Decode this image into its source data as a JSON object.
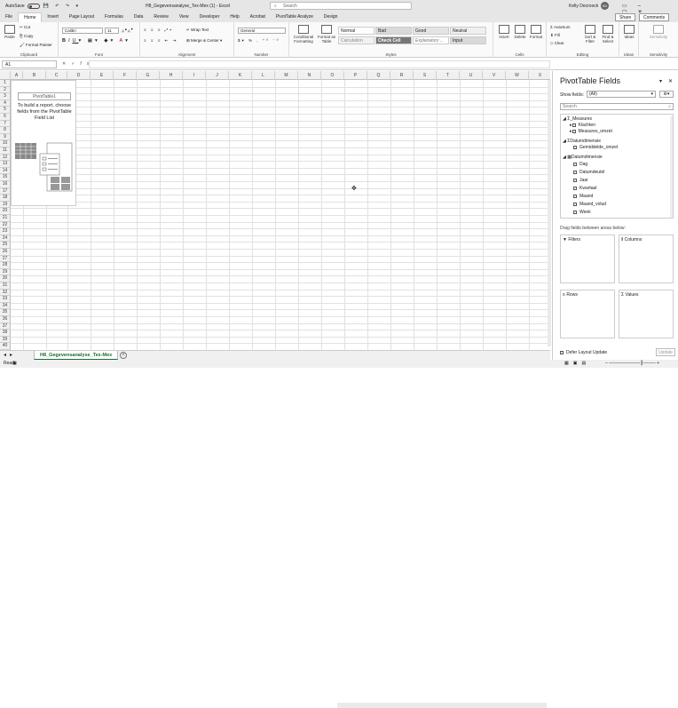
{
  "titlebar": {
    "autosave": "AutoSave",
    "toggle_state": "Off",
    "title": "H8_Gegevensanalyse_Tex-Mex (1) - Excel",
    "search_placeholder": "Search",
    "user": "Kelly Decroock",
    "avatar": "KD"
  },
  "menu": {
    "tabs": [
      "File",
      "Home",
      "Insert",
      "Page Layout",
      "Formulas",
      "Data",
      "Review",
      "View",
      "Developer",
      "Help",
      "Acrobat",
      "PivotTable Analyze",
      "Design"
    ],
    "share": "Share",
    "comments": "Comments"
  },
  "ribbon": {
    "clipboard": {
      "label": "Clipboard",
      "paste": "Paste",
      "cut": "Cut",
      "copy": "Copy",
      "format_painter": "Format Painter"
    },
    "font": {
      "label": "Font",
      "name": "Calibri",
      "size": "11"
    },
    "alignment": {
      "label": "Alignment",
      "wrap": "Wrap Text",
      "merge": "Merge & Center"
    },
    "number": {
      "label": "Number",
      "format": "General"
    },
    "styles": {
      "label": "Styles",
      "conditional": "Conditional Formatting",
      "format_table": "Format as Table",
      "cells": [
        "Normal",
        "Bad",
        "Good",
        "Neutral",
        "Calculation",
        "Check Cell",
        "Explanatory ...",
        "Input"
      ]
    },
    "cells": {
      "label": "Cells",
      "insert": "Insert",
      "delete": "Delete",
      "format": "Format"
    },
    "editing": {
      "label": "Editing",
      "autosum": "AutoSum",
      "fill": "Fill",
      "clear": "Clear",
      "sort": "Sort & Filter",
      "find": "Find & Select"
    },
    "ideas": {
      "label": "Ideas",
      "btn": "Ideas"
    },
    "sensitivity": {
      "label": "Sensitivity",
      "btn": "Sensitivity"
    }
  },
  "formula": {
    "cell": "A1",
    "fx": "fx",
    "value": ""
  },
  "grid": {
    "columns": [
      "A",
      "B",
      "C",
      "D",
      "E",
      "F",
      "G",
      "H",
      "I",
      "J",
      "K",
      "L",
      "M",
      "N",
      "O",
      "P",
      "Q",
      "R",
      "S",
      "T",
      "U",
      "V",
      "W",
      "X"
    ],
    "rows": [
      "1",
      "2",
      "3",
      "4",
      "5",
      "6",
      "7",
      "8",
      "9",
      "10",
      "11",
      "12",
      "13",
      "14",
      "15",
      "16",
      "17",
      "18",
      "19",
      "20",
      "21",
      "22",
      "23",
      "24",
      "25",
      "26",
      "27",
      "28",
      "29",
      "30",
      "31",
      "32",
      "33",
      "34",
      "35",
      "36",
      "37",
      "38",
      "39",
      "40"
    ]
  },
  "pivot_placeholder": {
    "name": "PivotTable1",
    "instructions": "To build a report, choose fields from the PivotTable Field List"
  },
  "sheet_tab": "H8_Gegevensanalyse_Tex-Mex",
  "status": {
    "ready": "Ready"
  },
  "panel": {
    "title": "PivotTable Fields",
    "show_fields_label": "Show fields:",
    "show_fields_value": "(All)",
    "search_placeholder": "Search",
    "fields": [
      {
        "label": "_Measures",
        "kind": "group"
      },
      {
        "label": "Klachten",
        "kind": "child"
      },
      {
        "label": "Measures_omzet",
        "kind": "child"
      },
      {
        "label": "Datumdimensie",
        "kind": "group"
      },
      {
        "label": "Gemiddelde_omzet",
        "kind": "child"
      },
      {
        "label": "Datumdimensie",
        "kind": "group"
      },
      {
        "label": "Dag",
        "kind": "leaf"
      },
      {
        "label": "Datumdeutel",
        "kind": "leaf"
      },
      {
        "label": "Jaar",
        "kind": "leaf"
      },
      {
        "label": "Kwartaal",
        "kind": "leaf"
      },
      {
        "label": "Maand",
        "kind": "leaf"
      },
      {
        "label": "Maand_volud",
        "kind": "leaf"
      },
      {
        "label": "Week",
        "kind": "leaf"
      }
    ],
    "drag_hint": "Drag fields between areas below:",
    "areas": {
      "filters": "Filters",
      "columns": "Columns",
      "rows": "Rows",
      "values": "Values"
    },
    "defer": "Defer Layout Update",
    "update": "Update"
  }
}
